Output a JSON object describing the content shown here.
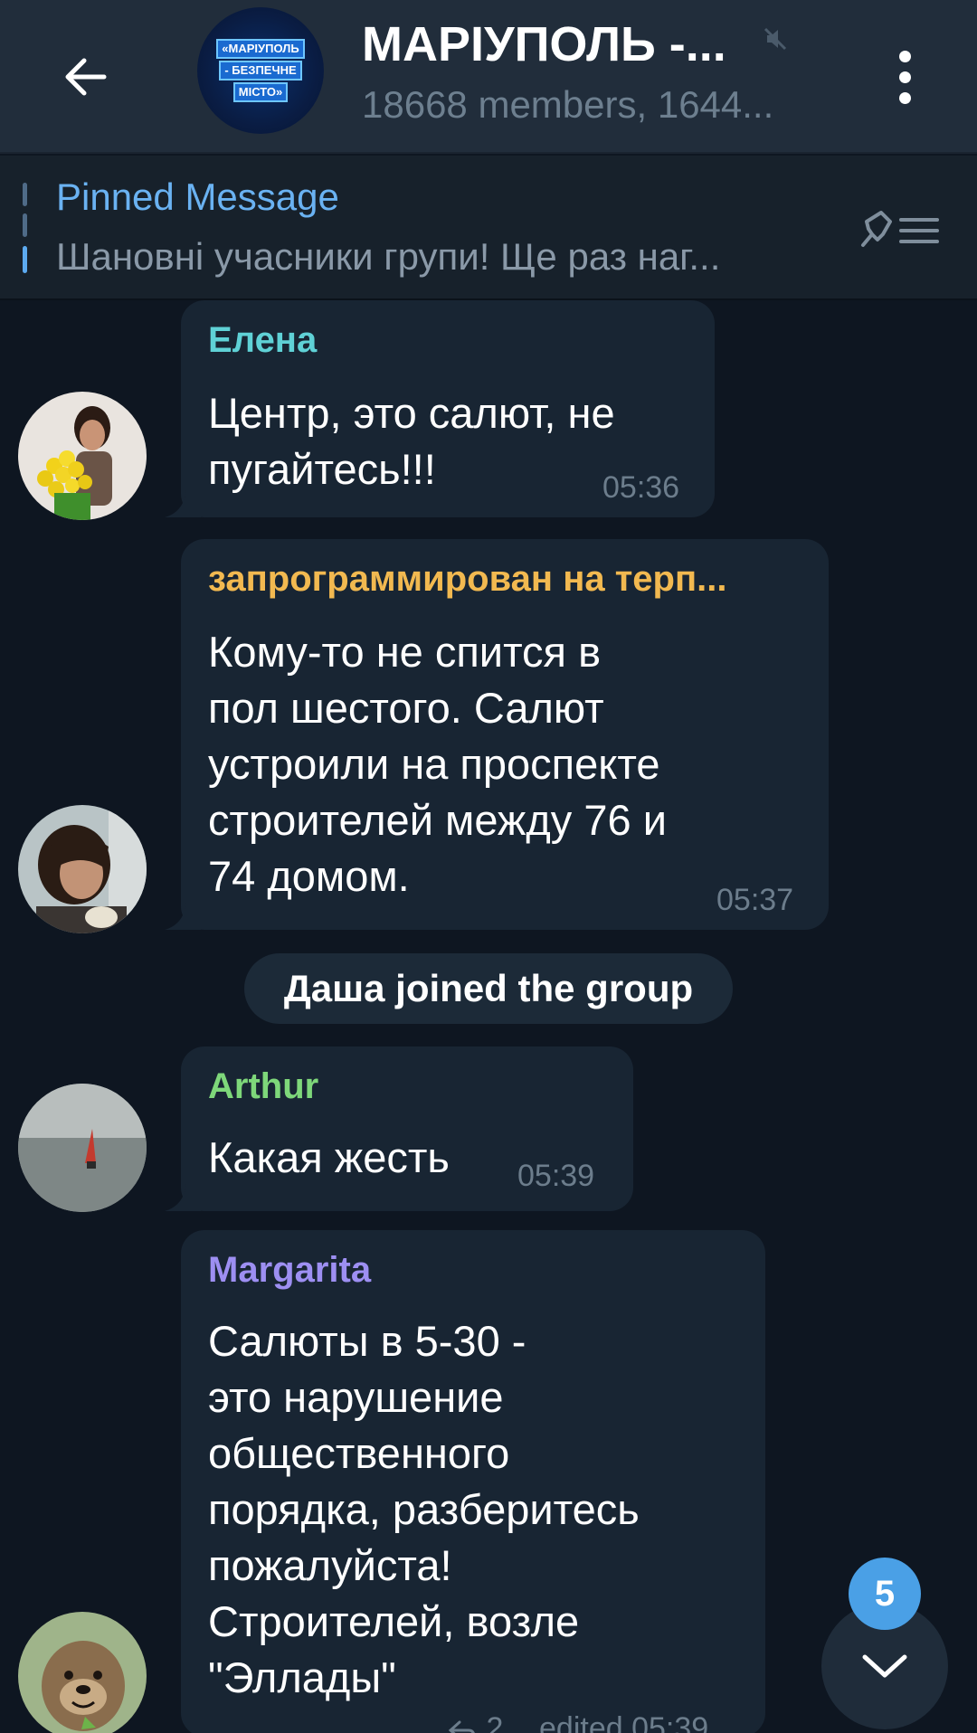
{
  "header": {
    "title": "МАРІУПОЛЬ -...",
    "subtitle": "18668 members, 1644...",
    "avatar_lines": [
      "«МАРІУПОЛЬ",
      "- БЕЗПЕЧНЕ",
      "МІСТО»"
    ],
    "icons": {
      "back": "arrow-left-icon",
      "mute": "mute-icon",
      "menu": "more-vert-icon"
    }
  },
  "pinned": {
    "title": "Pinned Message",
    "text": "Шановні учасники групи! Ще раз наг...",
    "icon": "pin-list-icon"
  },
  "messages": [
    {
      "sender": "Елена",
      "sender_color": "#5fd1d6",
      "text": "Центр, это салют, не\nпугайтесь!!!",
      "time": "05:36"
    },
    {
      "sender": "запрограммирован на терп...",
      "sender_color": "#f2b950",
      "text": "Кому-то не спится в\nпол шестого. Салют\nустроили на проспекте\nстроителей между 76 и\n74 домом.",
      "time": "05:37"
    },
    {
      "sender": "Arthur",
      "sender_color": "#7ed77a",
      "text": "Какая жесть",
      "time": "05:39"
    },
    {
      "sender": "Margarita",
      "sender_color": "#9d8ff2",
      "text": "Салюты в 5-30 -\nэто нарушение\nобщественного\nпорядка, разберитесь\nпожалуйста!\nСтроителей, возле\n\"Эллады\"",
      "reply_count": "2",
      "time": "edited 05:39"
    }
  ],
  "service_message": "Даша joined the group",
  "scroll": {
    "unread_count": "5",
    "icon": "chevron-down-icon"
  },
  "colors": {
    "background": "#0e1621",
    "header": "#212d3b",
    "bubble": "#182533",
    "accent": "#6ab2f2",
    "badge": "#4aa0e6"
  }
}
